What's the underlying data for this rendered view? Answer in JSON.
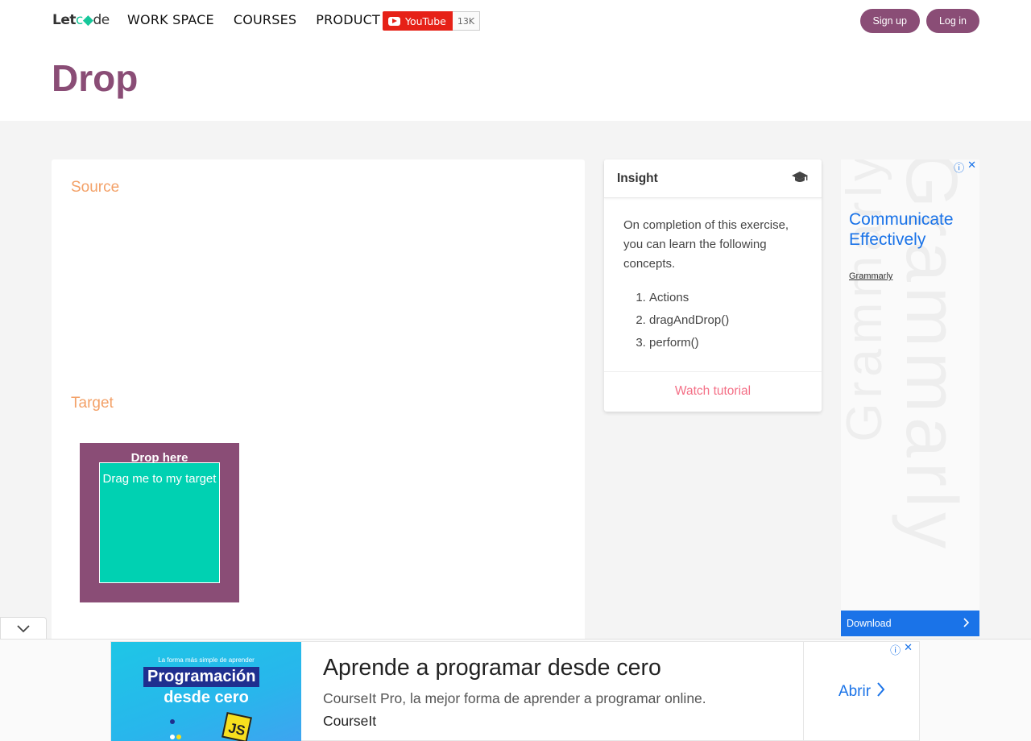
{
  "header": {
    "logo": {
      "part1": "Let",
      "part2": "c",
      "part3": "de"
    },
    "nav": [
      "WORK SPACE",
      "COURSES",
      "PRODUCT"
    ],
    "youtube": {
      "label": "YouTube",
      "count": "13K"
    },
    "signup_label": "Sign up",
    "login_label": "Log in"
  },
  "page": {
    "title": "Drop"
  },
  "practice": {
    "source_label": "Source",
    "target_label": "Target",
    "drop_label": "Drop here",
    "drag_label": "Drag me to my target"
  },
  "insight": {
    "title": "Insight",
    "icon": "graduation-cap-icon",
    "intro": "On completion of this exercise, you can learn the following concepts.",
    "concepts": [
      "Actions",
      "dragAndDrop()",
      "perform()"
    ],
    "footer_link": "Watch tutorial"
  },
  "side_ad": {
    "headline": "Communicate Effectively",
    "brand": "Grammarly",
    "watermark": "Grammarly",
    "cta": "Download"
  },
  "bottom_ad": {
    "image_small": "La forma más simple de aprender",
    "image_line1": "Programación",
    "image_line2": "desde cero",
    "image_badge": "JS",
    "headline": "Aprende a programar desde cero",
    "description": "CourseIt Pro, la mejor forma de aprender a programar online.",
    "brand": "CourseIt",
    "cta": "Abrir"
  },
  "colors": {
    "brand": "#8a4d76",
    "accent_orange": "#f3a168",
    "drag_teal": "#00d1b2",
    "link_pink": "#f46f86",
    "ad_blue": "#1a73e8"
  }
}
